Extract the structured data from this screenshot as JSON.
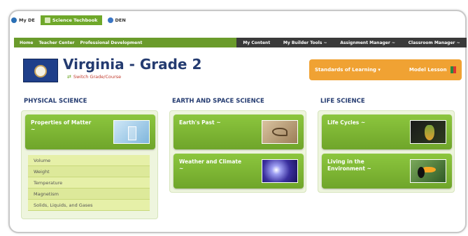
{
  "tabs": [
    {
      "label": "My DE",
      "icon": "de-globe-icon",
      "active": false
    },
    {
      "label": "Science Techbook",
      "icon": "techbook-icon",
      "active": true
    },
    {
      "label": "DEN",
      "icon": "den-people-icon",
      "active": false
    }
  ],
  "nav_left": [
    "Home",
    "Teacher Center",
    "Professional Development"
  ],
  "nav_right": [
    "My Content",
    "My Builder Tools ~",
    "Assignment Manager ~",
    "Classroom Manager ~"
  ],
  "header": {
    "title": "Virginia - Grade 2",
    "switch_link": "Switch Grade/Course",
    "standards_button": "Standards of Learning",
    "model_lesson_button": "Model Lesson"
  },
  "columns": [
    {
      "heading": "PHYSICAL SCIENCE",
      "cards": [
        {
          "label": "Properties of Matter",
          "dash": "~"
        }
      ],
      "subtopics": [
        "Volume",
        "Weight",
        "Temperature",
        "Magnetism",
        "Solids, Liquids, and Gases"
      ]
    },
    {
      "heading": "EARTH AND SPACE SCIENCE",
      "cards": [
        {
          "label": "Earth's Past ~",
          "dash": ""
        },
        {
          "label": "Weather and Climate",
          "dash": "~"
        }
      ]
    },
    {
      "heading": "LIFE SCIENCE",
      "cards": [
        {
          "label": "Life Cycles ~",
          "dash": ""
        },
        {
          "label": "Living in the",
          "dash": "Environment ~"
        }
      ]
    }
  ],
  "colors": {
    "accent_green": "#6fa82a",
    "nav_dark": "#3a3a3a",
    "orange": "#f0a233",
    "title_blue": "#243b70"
  }
}
